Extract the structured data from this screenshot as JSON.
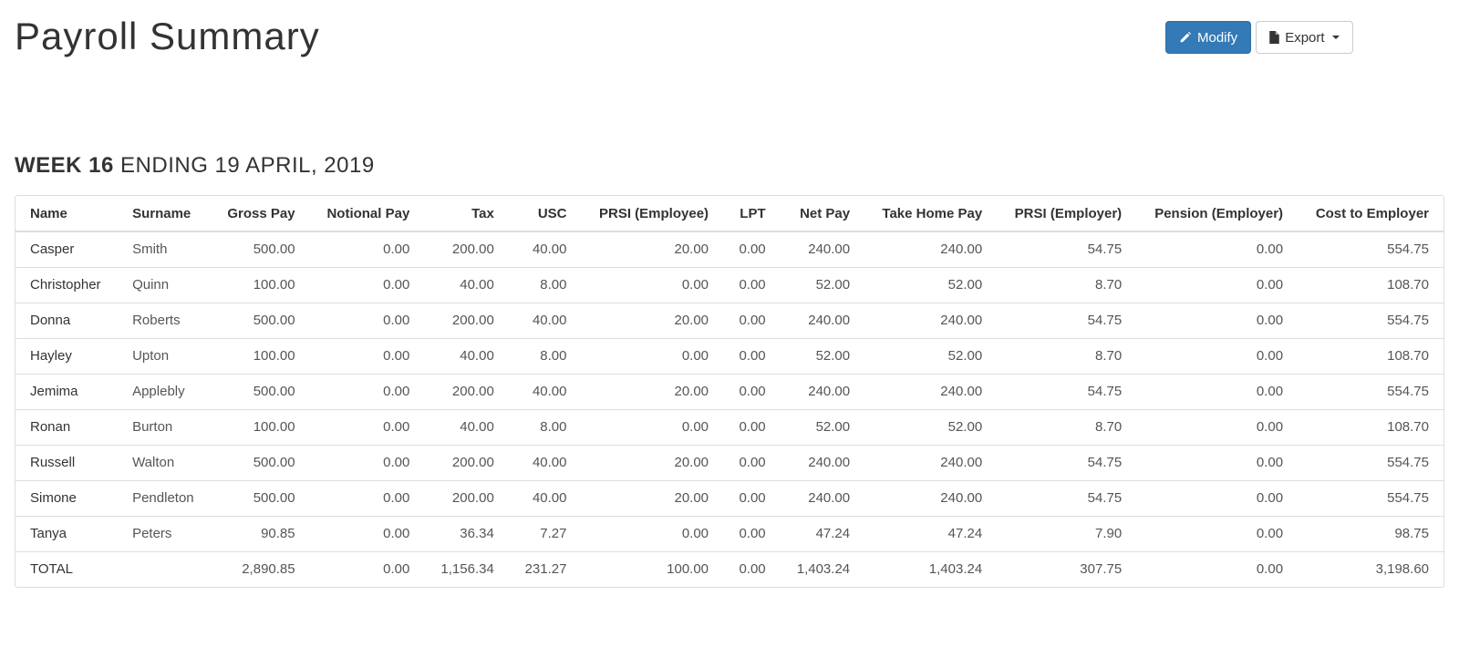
{
  "header": {
    "title": "Payroll Summary",
    "modify_label": "Modify",
    "export_label": "Export"
  },
  "section": {
    "week_label": "WEEK 16",
    "ending_label": "ENDING 19 APRIL, 2019"
  },
  "table": {
    "columns": [
      "Name",
      "Surname",
      "Gross Pay",
      "Notional Pay",
      "Tax",
      "USC",
      "PRSI (Employee)",
      "LPT",
      "Net Pay",
      "Take Home Pay",
      "PRSI (Employer)",
      "Pension (Employer)",
      "Cost to Employer"
    ],
    "rows": [
      [
        "Casper",
        "Smith",
        "500.00",
        "0.00",
        "200.00",
        "40.00",
        "20.00",
        "0.00",
        "240.00",
        "240.00",
        "54.75",
        "0.00",
        "554.75"
      ],
      [
        "Christopher",
        "Quinn",
        "100.00",
        "0.00",
        "40.00",
        "8.00",
        "0.00",
        "0.00",
        "52.00",
        "52.00",
        "8.70",
        "0.00",
        "108.70"
      ],
      [
        "Donna",
        "Roberts",
        "500.00",
        "0.00",
        "200.00",
        "40.00",
        "20.00",
        "0.00",
        "240.00",
        "240.00",
        "54.75",
        "0.00",
        "554.75"
      ],
      [
        "Hayley",
        "Upton",
        "100.00",
        "0.00",
        "40.00",
        "8.00",
        "0.00",
        "0.00",
        "52.00",
        "52.00",
        "8.70",
        "0.00",
        "108.70"
      ],
      [
        "Jemima",
        "Applebly",
        "500.00",
        "0.00",
        "200.00",
        "40.00",
        "20.00",
        "0.00",
        "240.00",
        "240.00",
        "54.75",
        "0.00",
        "554.75"
      ],
      [
        "Ronan",
        "Burton",
        "100.00",
        "0.00",
        "40.00",
        "8.00",
        "0.00",
        "0.00",
        "52.00",
        "52.00",
        "8.70",
        "0.00",
        "108.70"
      ],
      [
        "Russell",
        "Walton",
        "500.00",
        "0.00",
        "200.00",
        "40.00",
        "20.00",
        "0.00",
        "240.00",
        "240.00",
        "54.75",
        "0.00",
        "554.75"
      ],
      [
        "Simone",
        "Pendleton",
        "500.00",
        "0.00",
        "200.00",
        "40.00",
        "20.00",
        "0.00",
        "240.00",
        "240.00",
        "54.75",
        "0.00",
        "554.75"
      ],
      [
        "Tanya",
        "Peters",
        "90.85",
        "0.00",
        "36.34",
        "7.27",
        "0.00",
        "0.00",
        "47.24",
        "47.24",
        "7.90",
        "0.00",
        "98.75"
      ],
      [
        "TOTAL",
        "",
        "2,890.85",
        "0.00",
        "1,156.34",
        "231.27",
        "100.00",
        "0.00",
        "1,403.24",
        "1,403.24",
        "307.75",
        "0.00",
        "3,198.60"
      ]
    ]
  },
  "icons": {
    "modify": "pencil-icon",
    "export": "file-icon"
  },
  "colors": {
    "primary": "#337ab7",
    "border": "#dddddd",
    "text": "#333333"
  }
}
